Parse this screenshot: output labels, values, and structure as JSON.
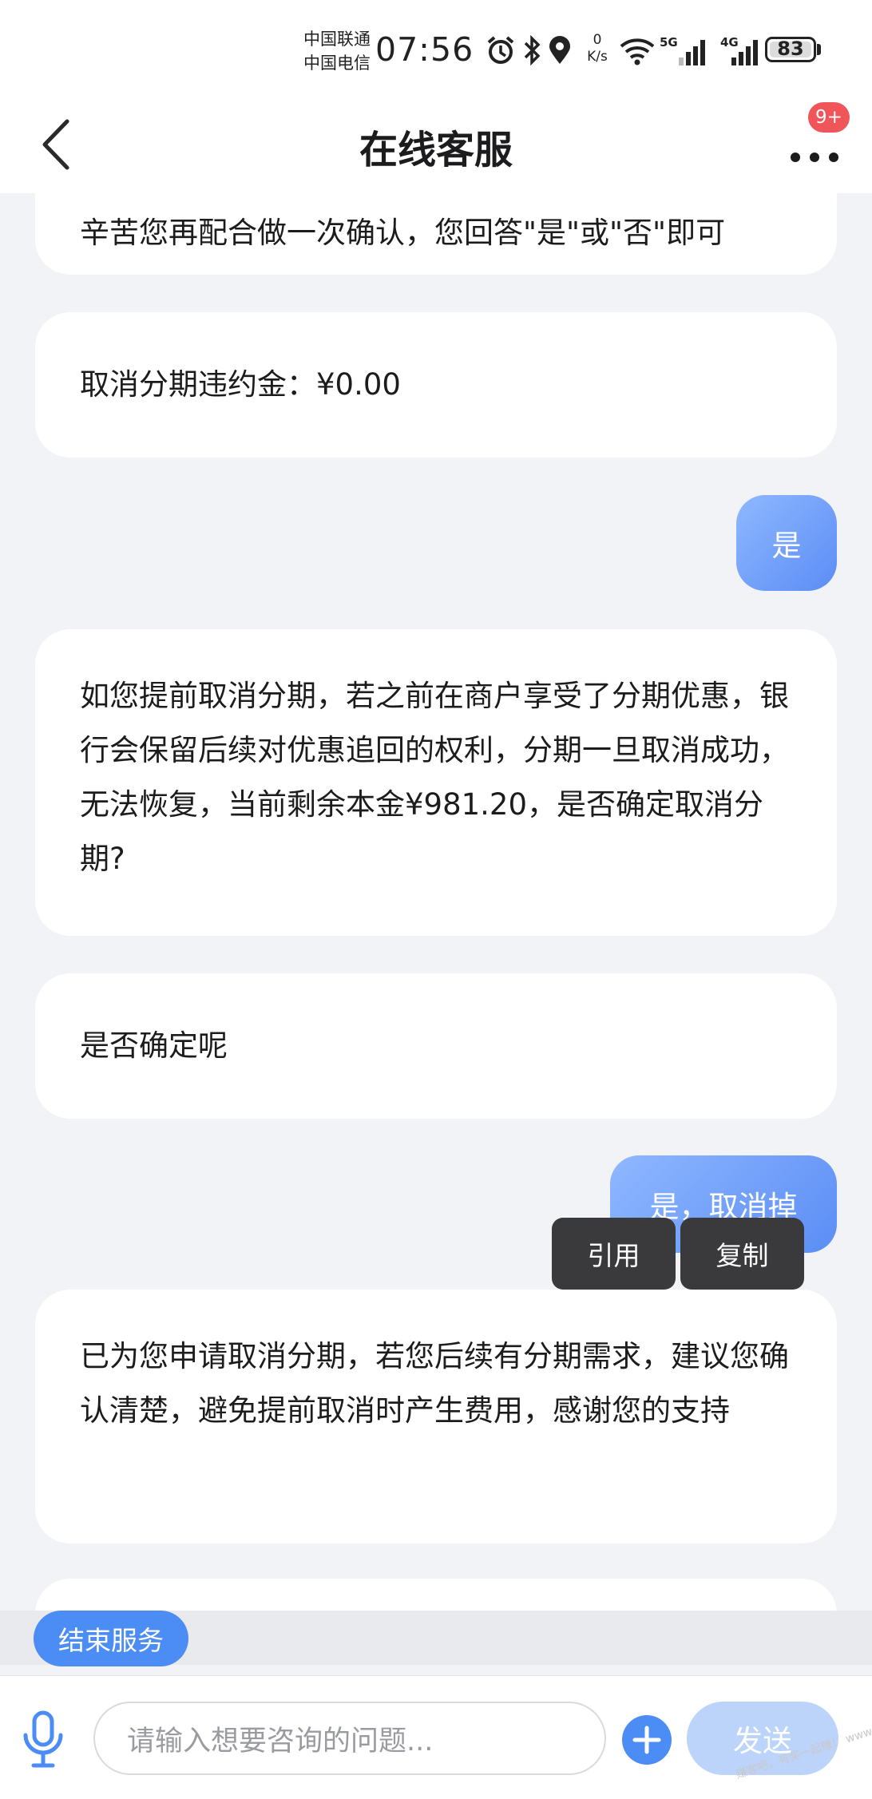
{
  "status_bar": {
    "carrier_1": "中国联通",
    "carrier_2": "中国电信",
    "time": "07:56",
    "net_speed_value": "0",
    "net_speed_unit": "K/s",
    "net_1": "5G",
    "net_2": "4G",
    "battery": "83",
    "icons": [
      "alarm-icon",
      "bluetooth-icon",
      "location-icon",
      "wifi-icon",
      "signal-icon",
      "signal-icon"
    ]
  },
  "nav": {
    "title": "在线客服",
    "badge": "9+"
  },
  "messages": {
    "m0": "辛苦您再配合做一次确认，您回答\"是\"或\"否\"即可",
    "m1": "取消分期违约金：¥0.00",
    "m2": "是",
    "m3": "如您提前取消分期，若之前在商户享受了分期优惠，银行会保留后续对优惠追回的权利，分期一旦取消成功，无法恢复，当前剩余本金¥981.20，是否确定取消分期?",
    "m4": "是否确定呢",
    "m5": "是，取消掉",
    "m6": "已为您申请取消分期，若您后续有分期需求，建议您确认清楚，避免提前取消时产生费用，感谢您的支持"
  },
  "context_menu": {
    "quote": "引用",
    "copy": "复制"
  },
  "end_service_label": "结束服务",
  "input": {
    "placeholder": "请输入想要咨询的问题...",
    "send_label": "发送"
  },
  "watermark": "赚客吧，有奖一起赚！ www.zuanke8.com",
  "colors": {
    "accent": "#4b8cf5",
    "bubble_out_start": "#8fb8ff",
    "bubble_out_end": "#5b8df5",
    "badge": "#f0555a",
    "send_disabled": "#bcd3fa"
  }
}
